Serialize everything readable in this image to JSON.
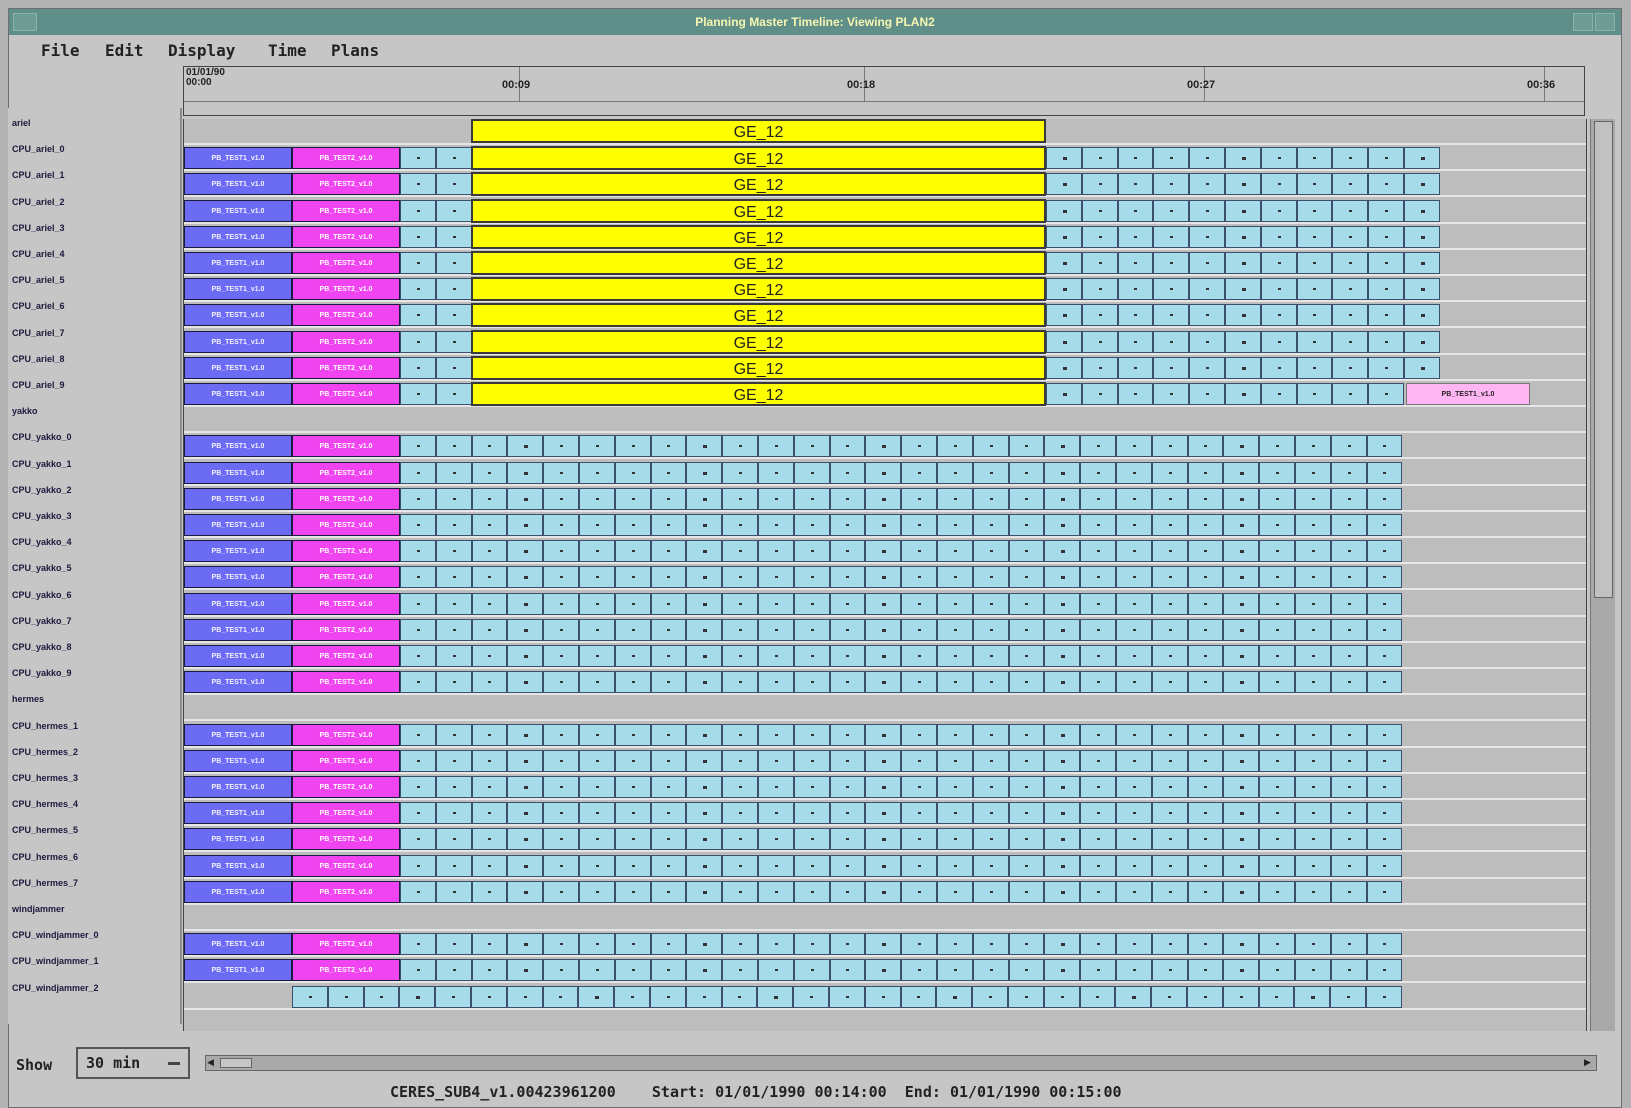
{
  "window": {
    "title": "Planning Master Timeline: Viewing PLAN2"
  },
  "menu": [
    "File",
    "Edit",
    "Display",
    "Time",
    "Plans"
  ],
  "time_header": {
    "start_date": "01/01/90",
    "start_time": "00:00",
    "ticks": [
      "00:09",
      "00:18",
      "00:27",
      "00:36"
    ]
  },
  "rows": [
    {
      "label": "ariel",
      "group": true
    },
    {
      "label": "CPU_ariel_0"
    },
    {
      "label": "CPU_ariel_1"
    },
    {
      "label": "CPU_ariel_2"
    },
    {
      "label": "CPU_ariel_3"
    },
    {
      "label": "CPU_ariel_4"
    },
    {
      "label": "CPU_ariel_5"
    },
    {
      "label": "CPU_ariel_6"
    },
    {
      "label": "CPU_ariel_7"
    },
    {
      "label": "CPU_ariel_8"
    },
    {
      "label": "CPU_ariel_9"
    },
    {
      "label": "yakko",
      "group": true
    },
    {
      "label": "CPU_yakko_0"
    },
    {
      "label": "CPU_yakko_1"
    },
    {
      "label": "CPU_yakko_2"
    },
    {
      "label": "CPU_yakko_3"
    },
    {
      "label": "CPU_yakko_4"
    },
    {
      "label": "CPU_yakko_5"
    },
    {
      "label": "CPU_yakko_6"
    },
    {
      "label": "CPU_yakko_7"
    },
    {
      "label": "CPU_yakko_8"
    },
    {
      "label": "CPU_yakko_9"
    },
    {
      "label": "hermes",
      "group": true
    },
    {
      "label": "CPU_hermes_1"
    },
    {
      "label": "CPU_hermes_2"
    },
    {
      "label": "CPU_hermes_3"
    },
    {
      "label": "CPU_hermes_4"
    },
    {
      "label": "CPU_hermes_5"
    },
    {
      "label": "CPU_hermes_6"
    },
    {
      "label": "CPU_hermes_7"
    },
    {
      "label": "windjammer",
      "group": true
    },
    {
      "label": "CPU_windjammer_0"
    },
    {
      "label": "CPU_windjammer_1"
    },
    {
      "label": "CPU_windjammer_2"
    }
  ],
  "task_labels": {
    "pb1": "PB_TEST1_v1.0",
    "pb2": "PB_TEST2_v1.0",
    "ge": "GE_12"
  },
  "colors": {
    "pb1": "#6b6bf3",
    "pb2": "#f044f0",
    "ge": "#ffff00",
    "small": "#a6dce9"
  },
  "footer": {
    "show_label": "Show",
    "show_value": "30 min",
    "status": {
      "job": "CERES_SUB4_v1.00423961200",
      "start_label": "Start:",
      "start_value": "01/01/1990 00:14:00",
      "end_label": "End:",
      "end_value": "01/01/1990 00:15:00"
    }
  }
}
